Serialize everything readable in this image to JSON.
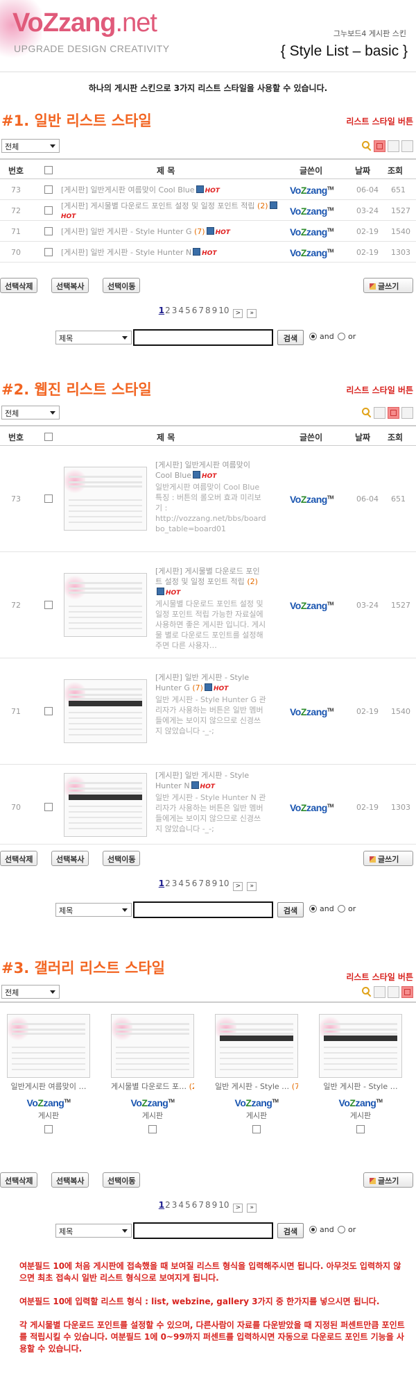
{
  "header": {
    "logo_text": "VoZzang",
    "logo_suffix": ".net",
    "logo_tagline": "UPGRADE DESIGN CREATIVITY",
    "skin_label": "그누보드4 게시판 스킨",
    "style_title": "{ Style List – basic }",
    "intro": "하나의 게시판 스킨으로 3가지 리스트 스타일을 사용할 수 있습니다."
  },
  "common": {
    "category_select": "전체",
    "style_button_note": "리스트 스타일 버튼",
    "columns": {
      "num": "번호",
      "subject": "제  목",
      "writer": "글쓴이",
      "date": "날짜",
      "hits": "조회"
    },
    "buttons": {
      "delete": "선택삭제",
      "copy": "선택복사",
      "move": "선택이동",
      "write": "글쓰기"
    },
    "pager": {
      "pages": [
        "1",
        "2",
        "3",
        "4",
        "5",
        "6",
        "7",
        "8",
        "9",
        "10"
      ],
      "next": ">",
      "last": "»"
    },
    "search": {
      "field": "제목",
      "button": "검색",
      "and": "and",
      "or": "or"
    },
    "writer": {
      "brand_a": "Vo",
      "brand_b": "Z",
      "brand_c": "zang",
      "tm": "TM"
    }
  },
  "section1": {
    "title": "#1. 일반 리스트 스타일",
    "rows": [
      {
        "num": "73",
        "subject": "[게시판] 일반게시판 여름맞이 Cool Blue",
        "comments": "",
        "date": "06-04",
        "hits": "651"
      },
      {
        "num": "72",
        "subject": "[게시판] 게시물별 다운로드 포인트 설정 및 일정 포인트 적립",
        "comments": "(2)",
        "date": "03-24",
        "hits": "1527"
      },
      {
        "num": "71",
        "subject": "[게시판] 일반 게시판 - Style Hunter G",
        "comments": "(7)",
        "date": "02-19",
        "hits": "1540"
      },
      {
        "num": "70",
        "subject": "[게시판] 일반 게시판 - Style Hunter N",
        "comments": "",
        "date": "02-19",
        "hits": "1303"
      }
    ]
  },
  "section2": {
    "title": "#2. 웹진 리스트 스타일",
    "rows": [
      {
        "num": "73",
        "subject": "[게시판] 일반게시판 여름맞이 Cool Blue",
        "comments": "",
        "excerpt": "일반게시판 여름맞이 Cool Blue 특징 : 버튼의 롤오버 효과 미리보기 : http://vozzang.net/bbs/board.php?bo_table=board01",
        "date": "06-04",
        "hits": "651"
      },
      {
        "num": "72",
        "subject": "[게시판] 게시물별 다운로드 포인트 설정 및 일정 포인트 적립",
        "comments": "(2)",
        "excerpt": "게시물별 다운로드 포인트 설정 및 일정 포인트 적립 가능한 자료실에 사용하면 좋은 게시판 입니다. 게시물 별로 다운로드 포인트를 설정해주면 다른 사용자…",
        "date": "03-24",
        "hits": "1527"
      },
      {
        "num": "71",
        "subject": "[게시판] 일반 게시판 - Style Hunter G",
        "comments": "(7)",
        "excerpt": "일반 게시판 - Style Hunter G 관리자가 사용하는 버튼은 일반 멤버들에게는 보이지 않으므로 신경쓰지 않았습니다 -_-;",
        "date": "02-19",
        "hits": "1540"
      },
      {
        "num": "70",
        "subject": "[게시판] 일반 게시판 - Style Hunter N",
        "comments": "",
        "excerpt": "일반 게시판 - Style Hunter N 관리자가 사용하는 버튼은 일반 멤버들에게는 보이지 않으므로 신경쓰지 않았습니다 -_-;",
        "date": "02-19",
        "hits": "1303"
      }
    ]
  },
  "section3": {
    "title": "#3. 갤러리 리스트 스타일",
    "items": [
      {
        "subject": "일반게시판 여름맞이 …",
        "comments": "",
        "category": "게시판"
      },
      {
        "subject": "게시물별 다운로드 포…",
        "comments": "(2)",
        "category": "게시판"
      },
      {
        "subject": "일반 게시판 - Style …",
        "comments": "(7)",
        "category": "게시판"
      },
      {
        "subject": "일반 게시판 - Style …",
        "comments": "",
        "category": "게시판"
      }
    ]
  },
  "notes": [
    "여분필드 10에 처음 게시판에 접속했을 때 보여질 리스트 형식을 입력해주시면 됩니다. 아무것도 입력하지 않으면 최초 접속시 일반 리스트 형식으로 보여지게 됩니다.",
    "여분필드 10에 입력할 리스트 형식 : list, webzine, gallery 3가지 중 한가지를 넣으시면 됩니다.",
    "각 게시물별 다운로드 포인트를 설정할 수 있으며, 다른사람이 자료를 다운받았을 때 지정된 퍼센트만큼 포인트를 적립시킬 수 있습니다. 여분필드 1에 0~99까지 퍼센트를 입력하시면 자동으로 다운로드 포인트 기능을 사용할 수 있습니다."
  ],
  "colors": {
    "accent": "#f26522",
    "note": "#d8231f",
    "brand": "#e05a7a"
  }
}
